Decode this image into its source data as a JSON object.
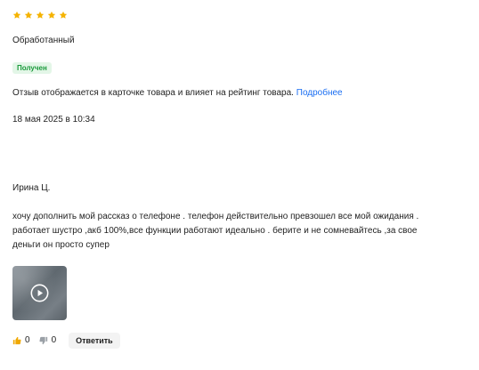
{
  "review": {
    "rating": 5,
    "rating_max": 5,
    "star_color": "#f5b300",
    "status": "Обработанный",
    "badge": "Получен",
    "info_text": "Отзыв отображается в карточке товара и влияет на рейтинг товара.",
    "info_link": "Подробнее",
    "date": "18 мая 2025 в 10:34"
  },
  "comment": {
    "author": "Ирина Ц.",
    "text": "хочу дополнить мой рассказ о телефоне . телефон действительно превзошел все мой ожидания . работает шустро ,акб 100%,все функции работают идеально . берите и не сомневайтесь ,за свое деньги он просто супер",
    "media": {
      "type": "video",
      "icon": "play-icon"
    },
    "likes": "0",
    "dislikes": "0",
    "reply_label": "Ответить"
  },
  "icons": {
    "star": "star-icon",
    "like": "thumbs-up-icon",
    "dislike": "thumbs-down-icon"
  },
  "colors": {
    "link": "#1a6ef2",
    "badge_text": "#1a9a3b",
    "badge_bg": "#e3f6e7",
    "like": "#f0a800",
    "dislike": "#9aa0a6"
  }
}
